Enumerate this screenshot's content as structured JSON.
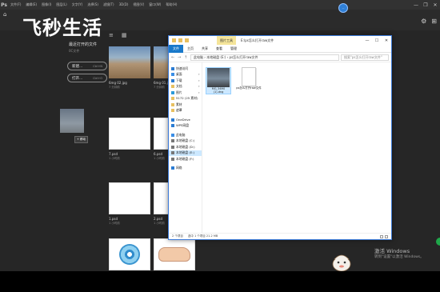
{
  "menubar": {
    "logo": "Ps",
    "items": [
      "文件(F)",
      "编辑(E)",
      "图像(I)",
      "图层(L)",
      "文字(Y)",
      "选择(S)",
      "滤镜(T)",
      "3D(D)",
      "视图(V)",
      "窗口(W)",
      "帮助(H)"
    ],
    "window_controls": [
      "—",
      "❐",
      "✕"
    ]
  },
  "watermark": "飞秒生活",
  "top_avatar": "...",
  "toolbar_right_icons": [
    "⚙",
    "⊞"
  ],
  "left_panel": {
    "title": "最近打开的文件",
    "subtitle": "0C文件",
    "new_label": "新建...",
    "new_shortcut": "Ctrl+N",
    "open_label": "打开...",
    "open_shortcut": "Ctrl+O",
    "drag_tip": "+ 移动"
  },
  "view_icons": [
    "≡",
    "▦"
  ],
  "thumbnails": [
    {
      "name": "6mg 02.jpg",
      "meta": "7 分钟前",
      "kind": "photo"
    },
    {
      "name": "6mg 01.jpg",
      "meta": "7 分钟前",
      "kind": "photo"
    },
    {
      "name": "7.psd",
      "meta": "1 小时前",
      "kind": "blank"
    },
    {
      "name": "6.psd",
      "meta": "1 小时前",
      "kind": "blank"
    },
    {
      "name": "1.psd",
      "meta": "1 小时前",
      "kind": "blank"
    },
    {
      "name": "2.psd",
      "meta": "1 小时前",
      "kind": "blank"
    },
    {
      "name": "",
      "meta": "",
      "kind": "cd"
    },
    {
      "name": "",
      "meta": "",
      "kind": "hand"
    }
  ],
  "explorer": {
    "context_tab": "图片工具",
    "path_title": "E:\\ps怎么打开raw文件",
    "ribbon": {
      "file": "文件",
      "tabs": [
        "主页",
        "共享",
        "查看",
        "管理"
      ]
    },
    "address": "此电脑 › 本地磁盘 (E:) › ps怎么打开raw文件",
    "search_placeholder": "搜索\"ps怎么打开raw文件\"",
    "nav_items": [
      {
        "label": "快速访问",
        "color": "#2b7cd3",
        "pin": false,
        "selected": false
      },
      {
        "label": "桌面",
        "color": "#3a8ee6",
        "pin": true,
        "selected": false
      },
      {
        "label": "下载",
        "color": "#2b7cd3",
        "pin": true,
        "selected": false
      },
      {
        "label": "文档",
        "color": "#e8c060",
        "pin": true,
        "selected": false
      },
      {
        "label": "图片",
        "color": "#2b9bd9",
        "pin": true,
        "selected": false
      },
      {
        "label": "5172 (25 素材)",
        "color": "#e8c060",
        "pin": false,
        "selected": false
      },
      {
        "label": "素材",
        "color": "#e8c060",
        "pin": false,
        "selected": false
      },
      {
        "label": "遮罩",
        "color": "#e8c060",
        "pin": false,
        "selected": false
      },
      {
        "label": "",
        "color": "",
        "pin": false,
        "selected": false
      },
      {
        "label": "OneDrive",
        "color": "#2b7cd3",
        "pin": false,
        "selected": false
      },
      {
        "label": "WPS网盘",
        "color": "#2b7cd3",
        "pin": false,
        "selected": false
      },
      {
        "label": "",
        "color": "",
        "pin": false,
        "selected": false
      },
      {
        "label": "此电脑",
        "color": "#3a8ee6",
        "pin": false,
        "selected": false
      },
      {
        "label": "本地磁盘 (C:)",
        "color": "#777",
        "pin": false,
        "selected": false
      },
      {
        "label": "本地磁盘 (D:)",
        "color": "#777",
        "pin": false,
        "selected": false
      },
      {
        "label": "本地磁盘 (E:)",
        "color": "#777",
        "pin": false,
        "selected": true
      },
      {
        "label": "本地磁盘 (F:)",
        "color": "#777",
        "pin": false,
        "selected": false
      },
      {
        "label": "",
        "color": "",
        "pin": false,
        "selected": false
      },
      {
        "label": "网络",
        "color": "#2b7cd3",
        "pin": false,
        "selected": false
      }
    ],
    "files": [
      {
        "name": "MG_5690 (1).dng",
        "kind": "photo",
        "selected": true
      },
      {
        "name": "ps怎么打开raw文件",
        "kind": "doc",
        "selected": false
      }
    ],
    "status": [
      "2 个项目",
      "选中 1 个项目 21.2 MB"
    ]
  },
  "activate": {
    "title": "激活 Windows",
    "subtitle": "转到\"设置\"以激活 Windows。"
  }
}
